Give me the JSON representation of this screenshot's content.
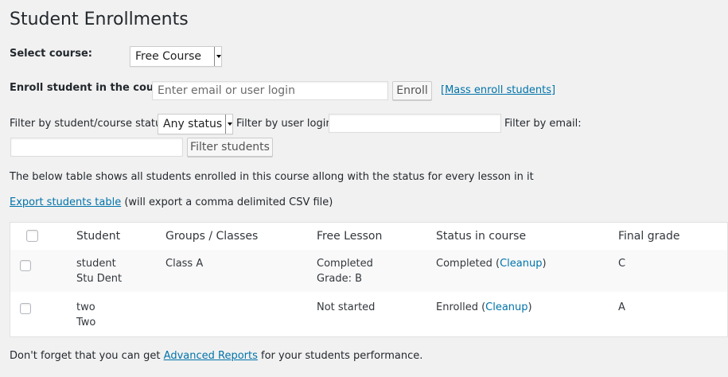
{
  "page": {
    "title": "Student Enrollments"
  },
  "select_course": {
    "label": "Select course:",
    "value": "Free Course"
  },
  "enroll": {
    "label": "Enroll student in the course:",
    "placeholder": "Enter email or user login",
    "button": "Enroll",
    "mass_link": "[Mass enroll students]"
  },
  "filters": {
    "status_label": "Filter by student/course status:",
    "status_value": "Any status",
    "login_label": "Filter by user login:",
    "login_value": "",
    "email_label": "Filter by email:",
    "email_value": "",
    "button": "Filter students"
  },
  "info_text": "The below table shows all students enrolled in this course allong with the status for every lesson in it",
  "export": {
    "link": "Export students table",
    "note": " (will export a comma delimited CSV file)"
  },
  "table": {
    "headers": [
      "Student",
      "Groups / Classes",
      "Free Lesson",
      "Status in course",
      "Final grade"
    ],
    "rows": [
      {
        "login": "student",
        "name": "Stu Dent",
        "group": "Class A",
        "lesson_status": "Completed",
        "lesson_grade": "Grade: B",
        "course_status": "Completed (",
        "cleanup": "Cleanup",
        "close": ")",
        "final_grade": "C"
      },
      {
        "login": "two",
        "name": "Two",
        "group": "",
        "lesson_status": "Not started",
        "lesson_grade": "",
        "course_status": "Enrolled (",
        "cleanup": "Cleanup",
        "close": ")",
        "final_grade": "A"
      }
    ]
  },
  "footer": {
    "before": "Don't forget that you can get ",
    "link": "Advanced Reports",
    "after": " for your students performance."
  }
}
